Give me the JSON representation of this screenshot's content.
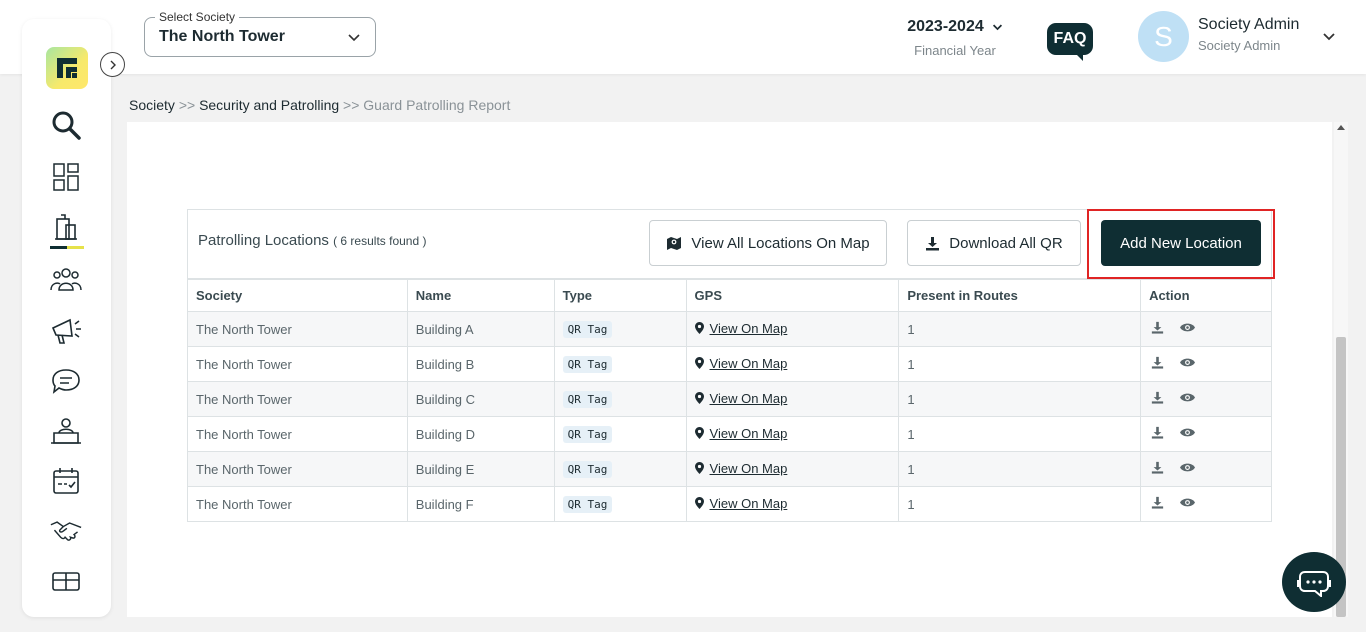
{
  "header": {
    "society_select": {
      "legend": "Select Society",
      "value": "The North Tower"
    },
    "financial_year": {
      "value": "2023-2024",
      "label": "Financial Year"
    },
    "faq_label": "FAQ",
    "user": {
      "initial": "S",
      "name": "Society Admin",
      "role": "Society Admin"
    }
  },
  "sidebar": {
    "items": [
      {
        "icon": "search-icon"
      },
      {
        "icon": "dashboard-icon"
      },
      {
        "icon": "building-icon",
        "active": true
      },
      {
        "icon": "members-icon"
      },
      {
        "icon": "announcement-icon"
      },
      {
        "icon": "chat-bubbles-icon"
      },
      {
        "icon": "helpdesk-icon"
      },
      {
        "icon": "calendar-icon"
      },
      {
        "icon": "handshake-icon"
      },
      {
        "icon": "amenities-icon"
      }
    ]
  },
  "breadcrumb": {
    "items": [
      "Society",
      "Security and Patrolling",
      "Guard Patrolling Report"
    ],
    "separator": ">>"
  },
  "card": {
    "title": "Patrolling Locations",
    "count_text": "( 6 results found )",
    "buttons": {
      "view_map": "View All Locations On Map",
      "download_qr": "Download All QR",
      "add_location": "Add New Location"
    }
  },
  "table": {
    "columns": [
      "Society",
      "Name",
      "Type",
      "GPS",
      "Present in Routes",
      "Action"
    ],
    "rows": [
      {
        "society": "The North Tower",
        "name": "Building A",
        "type": "QR Tag",
        "gps": "View On Map",
        "routes": "1"
      },
      {
        "society": "The North Tower",
        "name": "Building B",
        "type": "QR Tag",
        "gps": "View On Map",
        "routes": "1"
      },
      {
        "society": "The North Tower",
        "name": "Building C",
        "type": "QR Tag",
        "gps": "View On Map",
        "routes": "1"
      },
      {
        "society": "The North Tower",
        "name": "Building D",
        "type": "QR Tag",
        "gps": "View On Map",
        "routes": "1"
      },
      {
        "society": "The North Tower",
        "name": "Building E",
        "type": "QR Tag",
        "gps": "View On Map",
        "routes": "1"
      },
      {
        "society": "The North Tower",
        "name": "Building F",
        "type": "QR Tag",
        "gps": "View On Map",
        "routes": "1"
      }
    ]
  },
  "colors": {
    "primary": "#0f2e33",
    "highlight": "#e02424",
    "tag_bg": "#e6f0f7",
    "avatar_bg": "#bfe0f5"
  }
}
